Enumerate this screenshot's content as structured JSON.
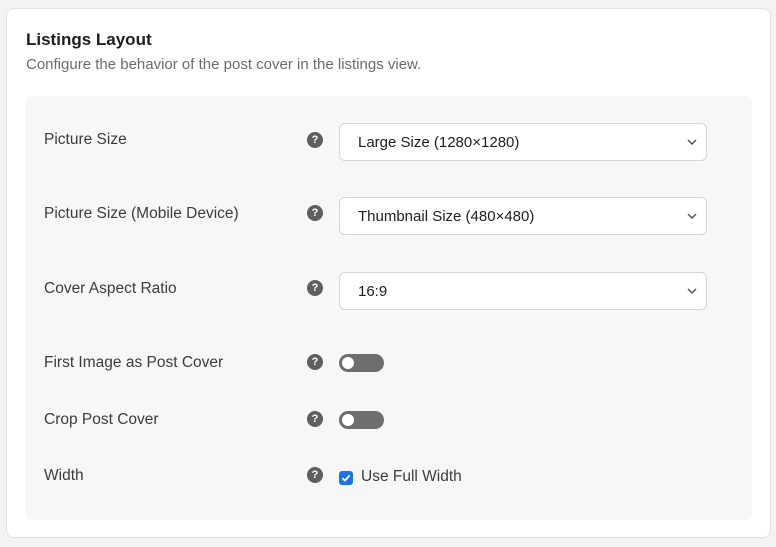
{
  "section": {
    "title": "Listings Layout",
    "description": "Configure the behavior of the post cover in the listings view."
  },
  "settings": {
    "picture_size": {
      "label": "Picture Size",
      "help_icon": "question-circle-icon",
      "value": "Large Size (1280×1280)"
    },
    "picture_size_mobile": {
      "label": "Picture Size (Mobile Device)",
      "help_icon": "question-circle-icon",
      "value": "Thumbnail Size (480×480)"
    },
    "cover_aspect_ratio": {
      "label": "Cover Aspect Ratio",
      "help_icon": "question-circle-icon",
      "value": "16:9"
    },
    "first_image_as_cover": {
      "label": "First Image as Post Cover",
      "help_icon": "question-circle-icon",
      "enabled": false
    },
    "crop_post_cover": {
      "label": "Crop Post Cover",
      "help_icon": "question-circle-icon",
      "enabled": false
    },
    "width": {
      "label": "Width",
      "help_icon": "question-circle-icon",
      "checkbox_label": "Use Full Width",
      "checked": true
    }
  },
  "colors": {
    "checkbox_accent": "#1a73e8",
    "toggle_off": "#6e6e6e",
    "panel_bg": "#f7f7f7"
  }
}
